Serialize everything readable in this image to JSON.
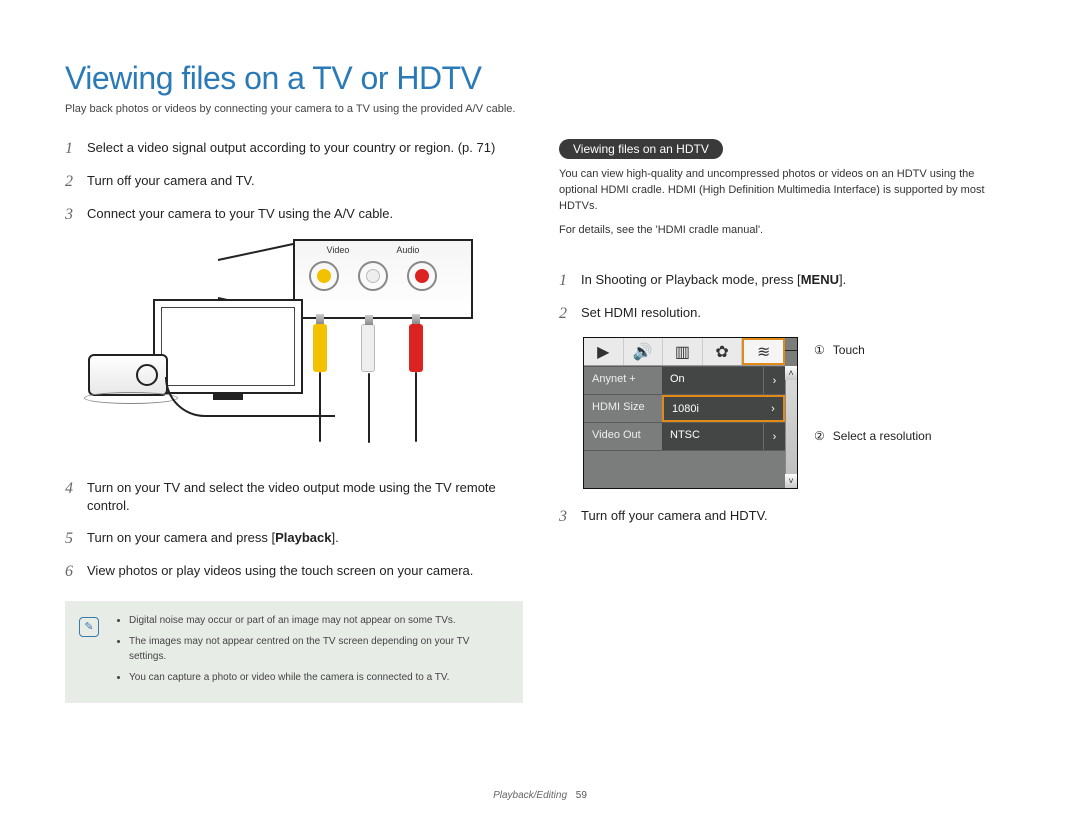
{
  "title": "Viewing files on a TV or HDTV",
  "subtitle": "Play back photos or videos by connecting your camera to a TV using the provided A/V cable.",
  "left_steps": [
    {
      "n": "1",
      "text": "Select a video signal output according to your country or region. (p. 71)"
    },
    {
      "n": "2",
      "text": "Turn off your camera and TV."
    },
    {
      "n": "3",
      "text": "Connect your camera to your TV using the A/V cable."
    },
    {
      "n": "4",
      "text": "Turn on your TV and select the video output mode using the TV remote control."
    },
    {
      "n": "5",
      "text": "Turn on your camera and press [Playback]."
    },
    {
      "n": "6",
      "text": "View photos or play videos using the touch screen on your camera."
    }
  ],
  "av_labels": {
    "video": "Video",
    "audio": "Audio"
  },
  "notes": [
    "Digital noise may occur or part of an image may not appear on some TVs.",
    "The images may not appear centred on the TV screen depending on your TV settings.",
    "You can capture a photo or video while the camera is connected to a TV."
  ],
  "hdtv": {
    "pill": "Viewing files on an HDTV",
    "para1": "You can view high-quality and uncompressed photos or videos on an HDTV using the optional HDMI cradle. HDMI (High Definition Multimedia Interface) is supported by most HDTVs.",
    "para2": "For details, see the 'HDMI cradle manual'.",
    "steps": [
      {
        "n": "1",
        "text": "In Shooting or Playback mode, press [MENU]."
      },
      {
        "n": "2",
        "text": "Set HDMI resolution."
      },
      {
        "n": "3",
        "text": "Turn off your camera and HDTV."
      }
    ],
    "menu": {
      "tabs_selected_index": 4,
      "rows": [
        {
          "label": "Anynet +",
          "value": "On"
        },
        {
          "label": "HDMI Size",
          "value": "1080i"
        },
        {
          "label": "Video Out",
          "value": "NTSC"
        }
      ],
      "selected_row_index": 1
    },
    "callouts": [
      {
        "marker": "①",
        "text": "Touch"
      },
      {
        "marker": "②",
        "text": "Select a resolution"
      }
    ]
  },
  "footer": {
    "section": "Playback/Editing",
    "page": "59"
  }
}
